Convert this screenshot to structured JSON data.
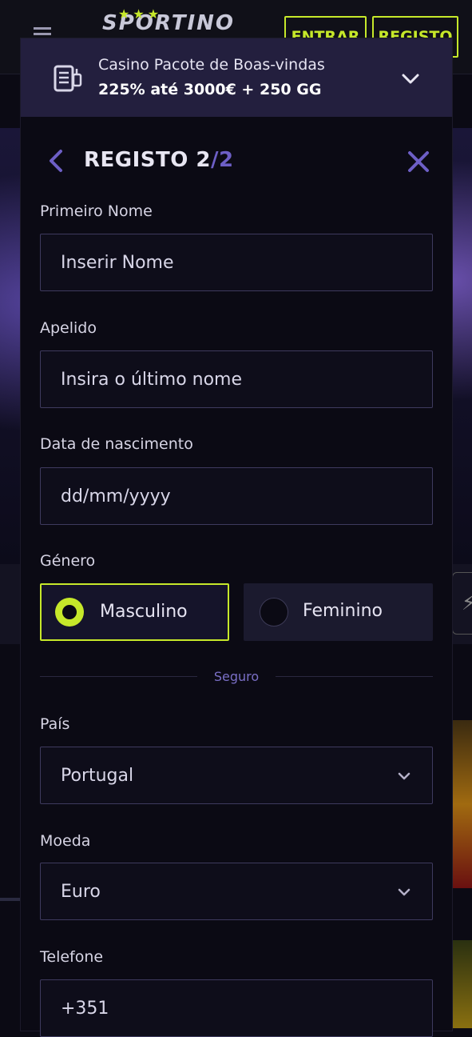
{
  "header": {
    "logo": "SPORTINO",
    "login_label": "ENTRAR",
    "register_label": "REGISTO"
  },
  "promo": {
    "title": "Casino Pacote de Boas-vindas",
    "subtitle": "225% até 3000€ + 250 GG"
  },
  "form": {
    "title": "REGISTO 2",
    "title_slash": "/",
    "title_total": "2",
    "first_name": {
      "label": "Primeiro Nome",
      "placeholder": "Inserir Nome"
    },
    "last_name": {
      "label": "Apelido",
      "placeholder": "Insira o último nome"
    },
    "birth_date": {
      "label": "Data de nascimento",
      "placeholder": "dd/mm/yyyy"
    },
    "gender": {
      "label": "Género",
      "options": [
        "Masculino",
        "Feminino"
      ],
      "selected": "Masculino"
    },
    "divider_label": "Seguro",
    "country": {
      "label": "País",
      "value": "Portugal"
    },
    "currency": {
      "label": "Moeda",
      "value": "Euro"
    },
    "phone": {
      "label": "Telefone",
      "value": "+351"
    }
  },
  "colors": {
    "accent": "#c6e82a",
    "purple": "#6d5fc6",
    "promo_bg": "#231f3e",
    "page_bg": "#0b0a14"
  }
}
